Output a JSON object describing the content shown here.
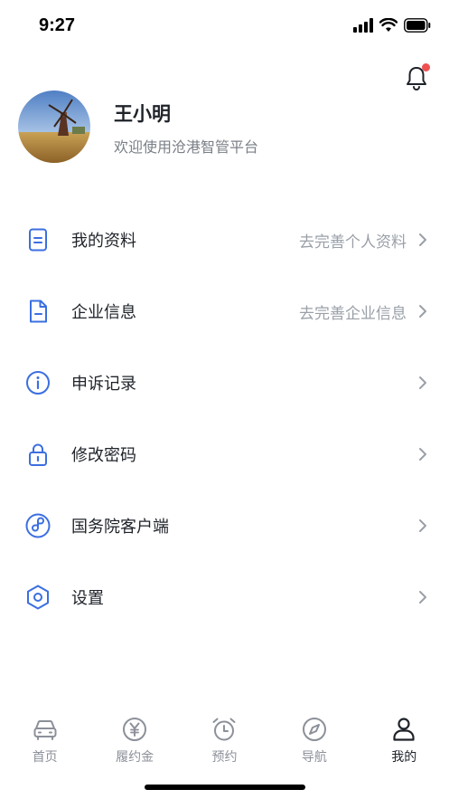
{
  "status": {
    "time": "9:27"
  },
  "profile": {
    "name": "王小明",
    "subtitle": "欢迎使用沧港智管平台"
  },
  "menu": [
    {
      "label": "我的资料",
      "hint": "去完善个人资料",
      "icon": "document-icon"
    },
    {
      "label": "企业信息",
      "hint": "去完善企业信息",
      "icon": "file-minus-icon"
    },
    {
      "label": "申诉记录",
      "hint": "",
      "icon": "info-circle-icon"
    },
    {
      "label": "修改密码",
      "hint": "",
      "icon": "lock-icon"
    },
    {
      "label": "国务院客户端",
      "hint": "",
      "icon": "link-circle-icon"
    },
    {
      "label": "设置",
      "hint": "",
      "icon": "settings-hexagon-icon"
    }
  ],
  "tabs": [
    {
      "label": "首页",
      "icon": "car-icon"
    },
    {
      "label": "履约金",
      "icon": "yen-coin-icon"
    },
    {
      "label": "预约",
      "icon": "alarm-clock-icon"
    },
    {
      "label": "导航",
      "icon": "compass-icon"
    },
    {
      "label": "我的",
      "icon": "user-icon"
    }
  ],
  "colors": {
    "accent": "#3b6fe0",
    "text": "#1f2329",
    "muted": "#9aa0a8",
    "badge": "#f04f4f"
  }
}
